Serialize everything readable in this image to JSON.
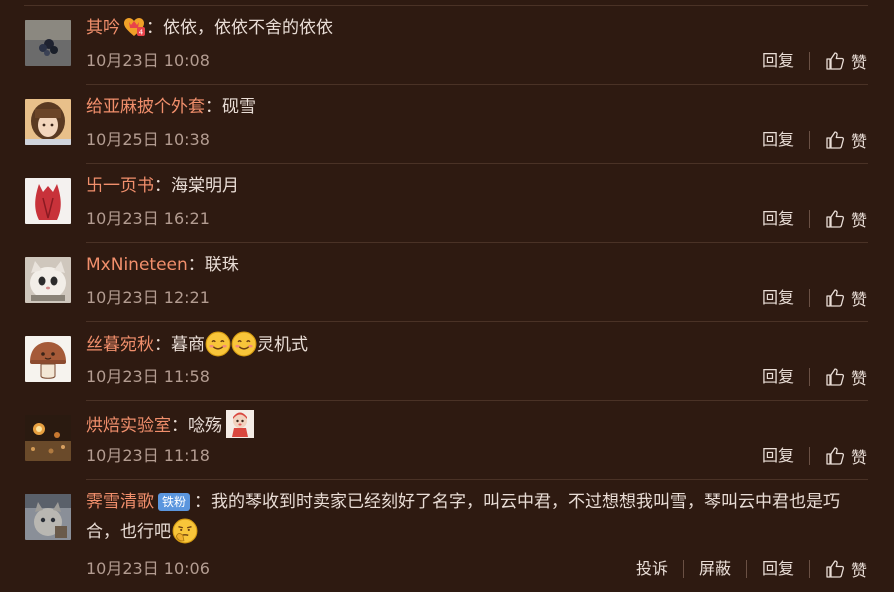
{
  "labels": {
    "reply": "回复",
    "like": "赞",
    "report": "投诉",
    "block": "屏蔽"
  },
  "comments": [
    {
      "author": "其吟",
      "text": "依依，依依不舍的依依",
      "time": "10月23日 10:08"
    },
    {
      "author": "给亚麻披个外套",
      "text": "砚雪",
      "time": "10月25日 10:38"
    },
    {
      "author": "卐一页书",
      "text": "海棠明月",
      "time": "10月23日 16:21"
    },
    {
      "author": "MxNineteen",
      "text": "联珠",
      "time": "10月23日 12:21"
    },
    {
      "author": "丝暮宛秋",
      "text_a": "暮商",
      "text_b": "灵机式",
      "time": "10月23日 11:58"
    },
    {
      "author": "烘焙实验室",
      "text": "唸殇",
      "time": "10月23日 11:18"
    },
    {
      "author": "霁雪清歌",
      "badge": "铁粉",
      "text": "我的琴收到时卖家已经刻好了名字，叫云中君，不过想想我叫雪，琴叫云中君也是巧合，也行吧",
      "time": "10月23日 10:06"
    }
  ],
  "colors": {
    "background": "#2e1a11",
    "author": "#f18f6c",
    "text": "#e9ddd6",
    "muted": "#b39c91",
    "badge": "#5b96de"
  }
}
